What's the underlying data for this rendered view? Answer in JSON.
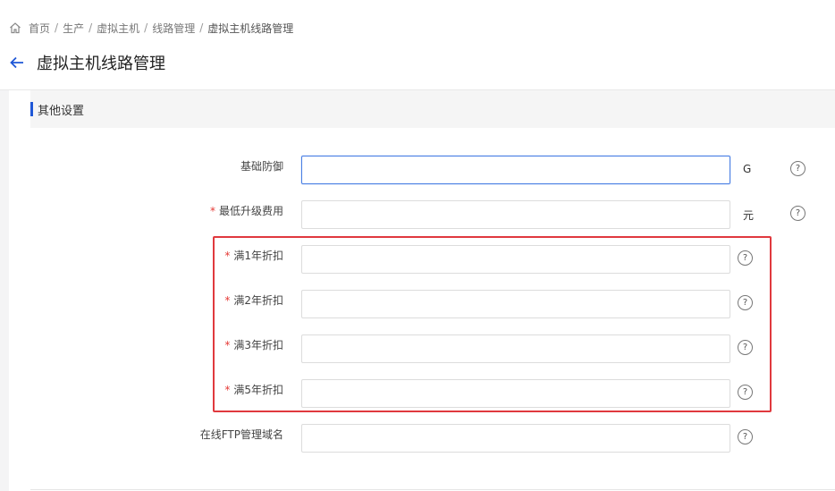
{
  "breadcrumb": {
    "items": [
      "首页",
      "生产",
      "虚拟主机",
      "线路管理"
    ],
    "separator": "/",
    "current": "虚拟主机线路管理"
  },
  "page": {
    "title": "虚拟主机线路管理"
  },
  "section": {
    "title": "其他设置"
  },
  "form": {
    "fields": [
      {
        "label": "基础防御",
        "required": false,
        "value": "",
        "unit": "G",
        "help": "?"
      },
      {
        "label": "最低升级费用",
        "required": true,
        "value": "",
        "unit": "元",
        "help": "?"
      },
      {
        "label": "满1年折扣",
        "required": true,
        "value": "",
        "help": "?"
      },
      {
        "label": "满2年折扣",
        "required": true,
        "value": "",
        "help": "?"
      },
      {
        "label": "满3年折扣",
        "required": true,
        "value": "",
        "help": "?"
      },
      {
        "label": "满5年折扣",
        "required": true,
        "value": "",
        "help": "?"
      },
      {
        "label": "在线FTP管理域名",
        "required": false,
        "value": "",
        "help": "?"
      }
    ],
    "required_mark": "*"
  },
  "colors": {
    "accent": "#1f57d6",
    "highlight": "#e0393e",
    "required": "#e53935"
  }
}
